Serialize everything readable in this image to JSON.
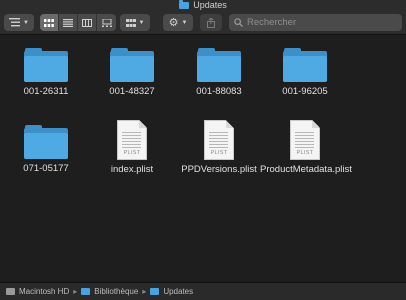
{
  "window": {
    "title": "Updates"
  },
  "toolbar": {
    "search_placeholder": "Rechercher",
    "icons": [
      "sidebar-list-icon",
      "icon-view-icon",
      "list-view-icon",
      "column-view-icon",
      "gallery-view-icon",
      "group-icon",
      "gear-icon",
      "share-icon",
      "search-icon"
    ]
  },
  "items": [
    {
      "kind": "folder",
      "name": "001-26311"
    },
    {
      "kind": "folder",
      "name": "001-48327"
    },
    {
      "kind": "folder",
      "name": "001-88083"
    },
    {
      "kind": "folder",
      "name": "001-96205"
    },
    {
      "kind": "folder",
      "name": "071-05177"
    },
    {
      "kind": "file",
      "name": "index.plist",
      "type": "PLIST"
    },
    {
      "kind": "file",
      "name": "PPDVersions.plist",
      "type": "PLIST"
    },
    {
      "kind": "file",
      "name": "ProductMetadata.plist",
      "type": "PLIST"
    }
  ],
  "pathbar": {
    "crumbs": [
      "Macintosh HD",
      "Bibliothèque",
      "Updates"
    ],
    "separator": "▸"
  },
  "colors": {
    "folder": "#4fa9e3",
    "background": "#1e1e1e",
    "toolbar": "#2c2c2c"
  }
}
